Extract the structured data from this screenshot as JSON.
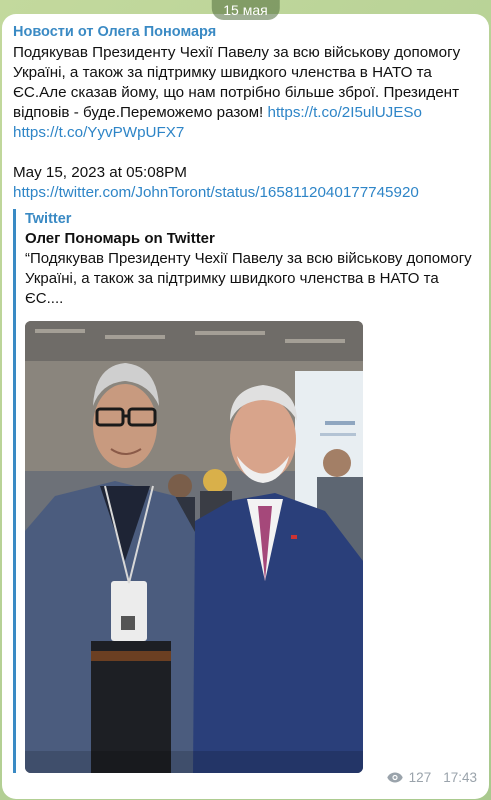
{
  "date_label": "15 мая",
  "channel_name": "Новости от Олега Пономаря",
  "message": {
    "text": "Подякував Президенту Чехії Павелу за всю військову допомогу Україні, а також за підтримку швидкого членства в НАТО та ЄС.Але сказав йому, що нам потрібно більше зброї. Президент відповів - буде.Переможемо разом! ",
    "link1": "https://t.co/2I5ulUJESo",
    "link2": "https://t.co/YyvPWpUFX7",
    "timestamp": "May 15, 2023 at 05:08PM",
    "tweet_url": "https://twitter.com/JohnToront/status/1658112040177745920"
  },
  "preview": {
    "site": "Twitter",
    "title": "Олег  Пономарь on Twitter",
    "description": "“Подякував Президенту Чехії Павелу за всю військову допомогу Україні, а також за підтримку швидкого членства в НАТО та ЄС...."
  },
  "footer": {
    "views": "127",
    "time": "17:43"
  },
  "colors": {
    "accent": "#3a8ac4",
    "link": "#2e85c7",
    "meta": "#9aa3ab"
  }
}
